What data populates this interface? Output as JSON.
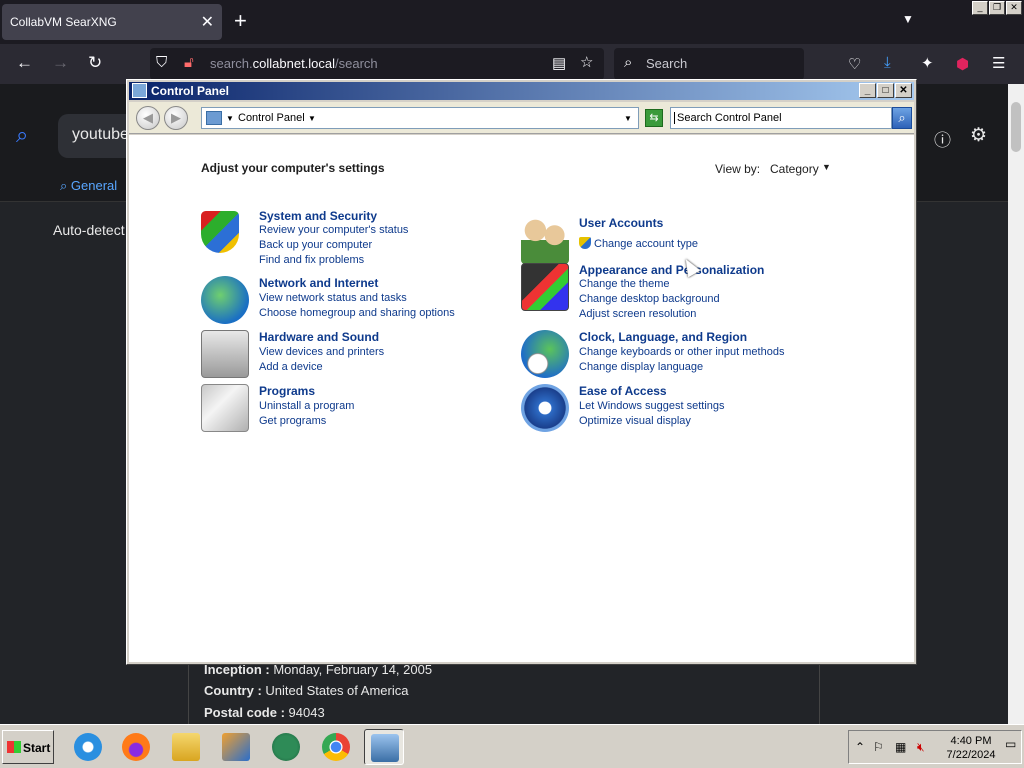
{
  "browser": {
    "tab_title": "CollabVM SearXNG",
    "tab_close": "✕",
    "new_tab": "+",
    "url_domain": "search.",
    "url_host": "collabnet.local",
    "url_path": "/search",
    "search_placeholder": "Search"
  },
  "webpage": {
    "query_partial": "youtube",
    "tab_general": "General",
    "autodetect": "Auto-detect",
    "info": [
      {
        "label": "Inception :",
        "value": " Monday, February 14, 2005"
      },
      {
        "label": "Country :",
        "value": " United States of America"
      },
      {
        "label": "Postal code :",
        "value": " 94043"
      }
    ]
  },
  "control_panel": {
    "window_title": "Control Panel",
    "address_path": "Control Panel",
    "search_placeholder": "Search Control Panel",
    "heading": "Adjust your computer's settings",
    "view_by_label": "View by:",
    "view_by_value": "Category",
    "categories": [
      {
        "title": "System and Security",
        "icon": "shield-icon",
        "links": [
          "Review your computer's status",
          "Back up your computer",
          "Find and fix problems"
        ]
      },
      {
        "title": "Network and Internet",
        "icon": "globe-network-icon",
        "links": [
          "View network status and tasks",
          "Choose homegroup and sharing options"
        ]
      },
      {
        "title": "Hardware and Sound",
        "icon": "printer-icon",
        "links": [
          "View devices and printers",
          "Add a device"
        ]
      },
      {
        "title": "Programs",
        "icon": "programs-icon",
        "links": [
          "Uninstall a program",
          "Get programs"
        ]
      },
      {
        "title": "User Accounts",
        "icon": "users-icon",
        "links": [
          "Change account type"
        ]
      },
      {
        "title": "Appearance and Personalization",
        "icon": "display-icon",
        "links": [
          "Change the theme",
          "Change desktop background",
          "Adjust screen resolution"
        ]
      },
      {
        "title": "Clock, Language, and Region",
        "icon": "clock-globe-icon",
        "links": [
          "Change keyboards or other input methods",
          "Change display language"
        ]
      },
      {
        "title": "Ease of Access",
        "icon": "ease-of-access-icon",
        "links": [
          "Let Windows suggest settings",
          "Optimize visual display"
        ]
      }
    ]
  },
  "taskbar": {
    "start_label": "Start",
    "time": "4:40 PM",
    "date": "7/22/2024",
    "apps": [
      "internet-explorer-icon",
      "firefox-icon",
      "file-explorer-icon",
      "media-player-icon",
      "chat-icon",
      "chrome-icon",
      "control-panel-icon"
    ]
  },
  "colors": {
    "link_blue": "#0e3a8c",
    "titlebar_start": "#0a246a",
    "titlebar_end": "#a6caf0"
  }
}
